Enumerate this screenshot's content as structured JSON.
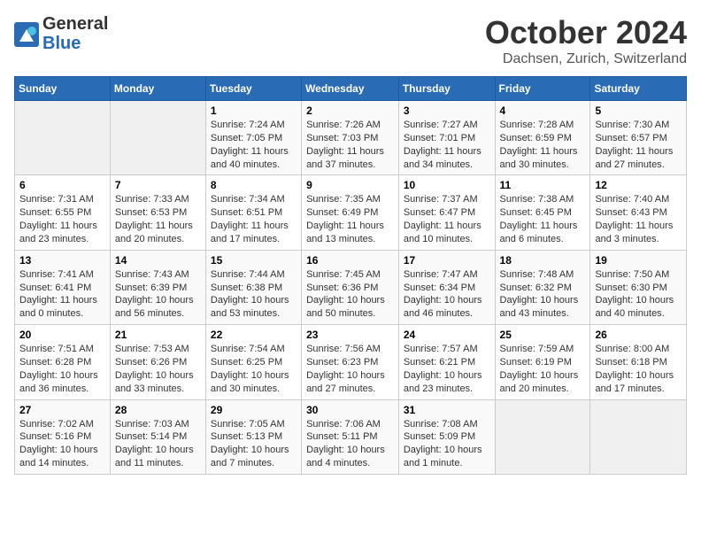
{
  "header": {
    "logo_general": "General",
    "logo_blue": "Blue",
    "month_title": "October 2024",
    "subtitle": "Dachsen, Zurich, Switzerland"
  },
  "weekdays": [
    "Sunday",
    "Monday",
    "Tuesday",
    "Wednesday",
    "Thursday",
    "Friday",
    "Saturday"
  ],
  "weeks": [
    [
      {
        "day": "",
        "sunrise": "",
        "sunset": "",
        "daylight": ""
      },
      {
        "day": "",
        "sunrise": "",
        "sunset": "",
        "daylight": ""
      },
      {
        "day": "1",
        "sunrise": "Sunrise: 7:24 AM",
        "sunset": "Sunset: 7:05 PM",
        "daylight": "Daylight: 11 hours and 40 minutes."
      },
      {
        "day": "2",
        "sunrise": "Sunrise: 7:26 AM",
        "sunset": "Sunset: 7:03 PM",
        "daylight": "Daylight: 11 hours and 37 minutes."
      },
      {
        "day": "3",
        "sunrise": "Sunrise: 7:27 AM",
        "sunset": "Sunset: 7:01 PM",
        "daylight": "Daylight: 11 hours and 34 minutes."
      },
      {
        "day": "4",
        "sunrise": "Sunrise: 7:28 AM",
        "sunset": "Sunset: 6:59 PM",
        "daylight": "Daylight: 11 hours and 30 minutes."
      },
      {
        "day": "5",
        "sunrise": "Sunrise: 7:30 AM",
        "sunset": "Sunset: 6:57 PM",
        "daylight": "Daylight: 11 hours and 27 minutes."
      }
    ],
    [
      {
        "day": "6",
        "sunrise": "Sunrise: 7:31 AM",
        "sunset": "Sunset: 6:55 PM",
        "daylight": "Daylight: 11 hours and 23 minutes."
      },
      {
        "day": "7",
        "sunrise": "Sunrise: 7:33 AM",
        "sunset": "Sunset: 6:53 PM",
        "daylight": "Daylight: 11 hours and 20 minutes."
      },
      {
        "day": "8",
        "sunrise": "Sunrise: 7:34 AM",
        "sunset": "Sunset: 6:51 PM",
        "daylight": "Daylight: 11 hours and 17 minutes."
      },
      {
        "day": "9",
        "sunrise": "Sunrise: 7:35 AM",
        "sunset": "Sunset: 6:49 PM",
        "daylight": "Daylight: 11 hours and 13 minutes."
      },
      {
        "day": "10",
        "sunrise": "Sunrise: 7:37 AM",
        "sunset": "Sunset: 6:47 PM",
        "daylight": "Daylight: 11 hours and 10 minutes."
      },
      {
        "day": "11",
        "sunrise": "Sunrise: 7:38 AM",
        "sunset": "Sunset: 6:45 PM",
        "daylight": "Daylight: 11 hours and 6 minutes."
      },
      {
        "day": "12",
        "sunrise": "Sunrise: 7:40 AM",
        "sunset": "Sunset: 6:43 PM",
        "daylight": "Daylight: 11 hours and 3 minutes."
      }
    ],
    [
      {
        "day": "13",
        "sunrise": "Sunrise: 7:41 AM",
        "sunset": "Sunset: 6:41 PM",
        "daylight": "Daylight: 11 hours and 0 minutes."
      },
      {
        "day": "14",
        "sunrise": "Sunrise: 7:43 AM",
        "sunset": "Sunset: 6:39 PM",
        "daylight": "Daylight: 10 hours and 56 minutes."
      },
      {
        "day": "15",
        "sunrise": "Sunrise: 7:44 AM",
        "sunset": "Sunset: 6:38 PM",
        "daylight": "Daylight: 10 hours and 53 minutes."
      },
      {
        "day": "16",
        "sunrise": "Sunrise: 7:45 AM",
        "sunset": "Sunset: 6:36 PM",
        "daylight": "Daylight: 10 hours and 50 minutes."
      },
      {
        "day": "17",
        "sunrise": "Sunrise: 7:47 AM",
        "sunset": "Sunset: 6:34 PM",
        "daylight": "Daylight: 10 hours and 46 minutes."
      },
      {
        "day": "18",
        "sunrise": "Sunrise: 7:48 AM",
        "sunset": "Sunset: 6:32 PM",
        "daylight": "Daylight: 10 hours and 43 minutes."
      },
      {
        "day": "19",
        "sunrise": "Sunrise: 7:50 AM",
        "sunset": "Sunset: 6:30 PM",
        "daylight": "Daylight: 10 hours and 40 minutes."
      }
    ],
    [
      {
        "day": "20",
        "sunrise": "Sunrise: 7:51 AM",
        "sunset": "Sunset: 6:28 PM",
        "daylight": "Daylight: 10 hours and 36 minutes."
      },
      {
        "day": "21",
        "sunrise": "Sunrise: 7:53 AM",
        "sunset": "Sunset: 6:26 PM",
        "daylight": "Daylight: 10 hours and 33 minutes."
      },
      {
        "day": "22",
        "sunrise": "Sunrise: 7:54 AM",
        "sunset": "Sunset: 6:25 PM",
        "daylight": "Daylight: 10 hours and 30 minutes."
      },
      {
        "day": "23",
        "sunrise": "Sunrise: 7:56 AM",
        "sunset": "Sunset: 6:23 PM",
        "daylight": "Daylight: 10 hours and 27 minutes."
      },
      {
        "day": "24",
        "sunrise": "Sunrise: 7:57 AM",
        "sunset": "Sunset: 6:21 PM",
        "daylight": "Daylight: 10 hours and 23 minutes."
      },
      {
        "day": "25",
        "sunrise": "Sunrise: 7:59 AM",
        "sunset": "Sunset: 6:19 PM",
        "daylight": "Daylight: 10 hours and 20 minutes."
      },
      {
        "day": "26",
        "sunrise": "Sunrise: 8:00 AM",
        "sunset": "Sunset: 6:18 PM",
        "daylight": "Daylight: 10 hours and 17 minutes."
      }
    ],
    [
      {
        "day": "27",
        "sunrise": "Sunrise: 7:02 AM",
        "sunset": "Sunset: 5:16 PM",
        "daylight": "Daylight: 10 hours and 14 minutes."
      },
      {
        "day": "28",
        "sunrise": "Sunrise: 7:03 AM",
        "sunset": "Sunset: 5:14 PM",
        "daylight": "Daylight: 10 hours and 11 minutes."
      },
      {
        "day": "29",
        "sunrise": "Sunrise: 7:05 AM",
        "sunset": "Sunset: 5:13 PM",
        "daylight": "Daylight: 10 hours and 7 minutes."
      },
      {
        "day": "30",
        "sunrise": "Sunrise: 7:06 AM",
        "sunset": "Sunset: 5:11 PM",
        "daylight": "Daylight: 10 hours and 4 minutes."
      },
      {
        "day": "31",
        "sunrise": "Sunrise: 7:08 AM",
        "sunset": "Sunset: 5:09 PM",
        "daylight": "Daylight: 10 hours and 1 minute."
      },
      {
        "day": "",
        "sunrise": "",
        "sunset": "",
        "daylight": ""
      },
      {
        "day": "",
        "sunrise": "",
        "sunset": "",
        "daylight": ""
      }
    ]
  ]
}
